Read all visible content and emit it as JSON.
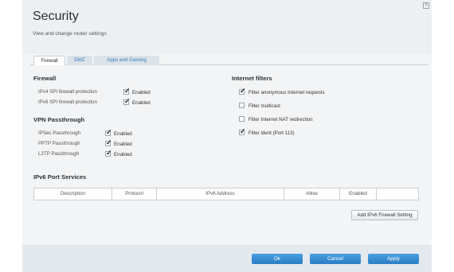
{
  "header": {
    "title": "Security",
    "subtitle": "View and change router settings",
    "close": "×"
  },
  "tabs": [
    {
      "label": "Firewall",
      "active": true
    },
    {
      "label": "DMZ",
      "active": false
    },
    {
      "label": "Apps and Gaming",
      "active": false
    }
  ],
  "firewall": {
    "title": "Firewall",
    "rows": [
      {
        "label": "IPv4 SPI firewall protection",
        "checked": true,
        "value": "Enabled"
      },
      {
        "label": "IPv6 SPI firewall protection",
        "checked": true,
        "value": "Enabled"
      }
    ]
  },
  "vpn": {
    "title": "VPN Passthrough",
    "rows": [
      {
        "label": "IPSec Passthrough",
        "checked": true,
        "value": "Enabled"
      },
      {
        "label": "PPTP Passthrough",
        "checked": true,
        "value": "Enabled"
      },
      {
        "label": "L2TP Passthrough",
        "checked": true,
        "value": "Enabled"
      }
    ]
  },
  "internet_filters": {
    "title": "Internet filters",
    "items": [
      {
        "label": "Filter anonymous Internet requests",
        "checked": true
      },
      {
        "label": "Filter multicast",
        "checked": false
      },
      {
        "label": "Filter Internet NAT redirection",
        "checked": false
      },
      {
        "label": "Filter ident (Port 113)",
        "checked": true
      }
    ]
  },
  "ipv6_port_services": {
    "title": "IPv6 Port Services",
    "columns": [
      "Description",
      "Protocol",
      "IPv6 Address",
      "Allow",
      "Enabled",
      ""
    ],
    "add_button": "Add IPv6 Firewall Setting"
  },
  "footer": {
    "ok": "Ok",
    "cancel": "Cancel",
    "apply": "Apply"
  },
  "colors": {
    "accent": "#2f7fc1",
    "button": "#3a8fd2"
  }
}
